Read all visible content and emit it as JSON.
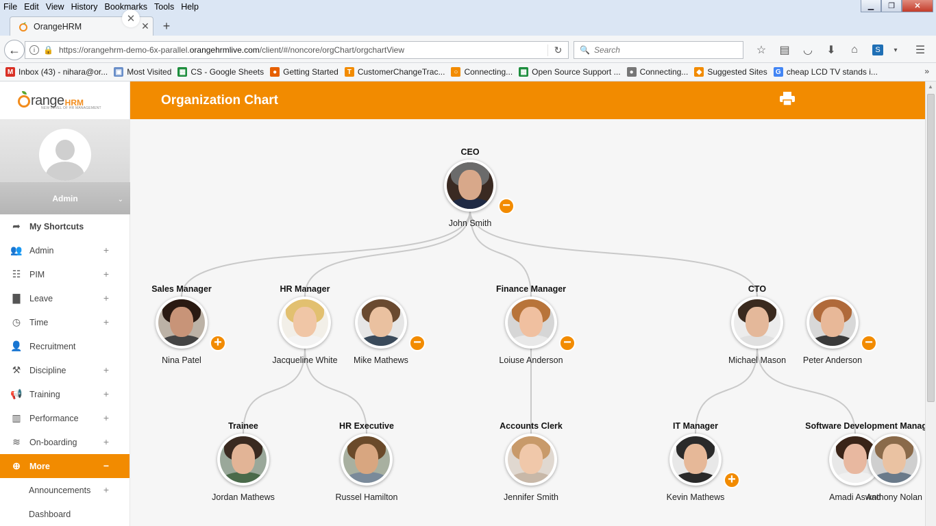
{
  "browser": {
    "menu": [
      "File",
      "Edit",
      "View",
      "History",
      "Bookmarks",
      "Tools",
      "Help"
    ],
    "tab_title": "OrangeHRM",
    "url_prefix": "https://orangehrm-demo-6x-parallel.",
    "url_domain": "orangehrmlive.com",
    "url_suffix": "/client/#/noncore/orgChart/orgchartView",
    "search_placeholder": "Search",
    "bookmarks": [
      {
        "label": "Inbox (43) - nihara@or...",
        "icon": "gmail-icon",
        "color": "#d93025",
        "glyph": "M"
      },
      {
        "label": "Most Visited",
        "icon": "folder-icon",
        "color": "#6a8fc9",
        "glyph": "▣"
      },
      {
        "label": "CS - Google Sheets",
        "icon": "sheets-icon",
        "color": "#1e8e3e",
        "glyph": "▦"
      },
      {
        "label": "Getting Started",
        "icon": "firefox-icon",
        "color": "#e66000",
        "glyph": "●"
      },
      {
        "label": "CustomerChangeTrac...",
        "icon": "tracker-icon",
        "color": "#f28b00",
        "glyph": "T"
      },
      {
        "label": "Connecting...",
        "icon": "orangehrm-icon",
        "color": "#f28b00",
        "glyph": "○"
      },
      {
        "label": "Open Source Support ...",
        "icon": "sheets-icon",
        "color": "#1e8e3e",
        "glyph": "▦"
      },
      {
        "label": "Connecting...",
        "icon": "globe-icon",
        "color": "#777777",
        "glyph": "●"
      },
      {
        "label": "Suggested Sites",
        "icon": "suggested-icon",
        "color": "#f28b00",
        "glyph": "◆"
      },
      {
        "label": "cheap LCD TV stands i...",
        "icon": "google-icon",
        "color": "#4285f4",
        "glyph": "G"
      }
    ]
  },
  "sidebar": {
    "logo_text": "range",
    "logo_hrm": "HRM",
    "logo_tagline": "NEW LEVEL OF HR MANAGEMENT",
    "user": "Admin",
    "items": [
      {
        "label": "My Shortcuts",
        "icon": "share-arrow-icon",
        "glyph": "➦",
        "plus": false,
        "style": "bold"
      },
      {
        "label": "Admin",
        "icon": "admin-users-icon",
        "glyph": "👥",
        "plus": true,
        "style": ""
      },
      {
        "label": "PIM",
        "icon": "pim-icon",
        "glyph": "☷",
        "plus": true,
        "style": ""
      },
      {
        "label": "Leave",
        "icon": "briefcase-icon",
        "glyph": "▇",
        "plus": true,
        "style": ""
      },
      {
        "label": "Time",
        "icon": "clock-icon",
        "glyph": "◷",
        "plus": true,
        "style": ""
      },
      {
        "label": "Recruitment",
        "icon": "recruitment-icon",
        "glyph": "👤",
        "plus": false,
        "style": ""
      },
      {
        "label": "Discipline",
        "icon": "gavel-icon",
        "glyph": "⚒",
        "plus": true,
        "style": ""
      },
      {
        "label": "Training",
        "icon": "megaphone-icon",
        "glyph": "📢",
        "plus": true,
        "style": ""
      },
      {
        "label": "Performance",
        "icon": "bar-chart-icon",
        "glyph": "▥",
        "plus": true,
        "style": ""
      },
      {
        "label": "On-boarding",
        "icon": "stack-icon",
        "glyph": "≋",
        "plus": true,
        "style": ""
      },
      {
        "label": "More",
        "icon": "plus-circle-icon",
        "glyph": "⊕",
        "plus": true,
        "minus": true,
        "style": "active"
      }
    ],
    "subitems": [
      {
        "label": "Announcements",
        "plus": true
      },
      {
        "label": "Dashboard",
        "plus": false
      }
    ]
  },
  "main": {
    "title": "Organization Chart"
  },
  "org": {
    "nodes": [
      {
        "id": "ceo",
        "title": "CEO",
        "name": "John Smith",
        "toggle": "minus",
        "hair": "#6b6b6b",
        "skin": "#d8a88a",
        "shirt": "#1f2a44",
        "bg": "#3a2a22"
      },
      {
        "id": "sales",
        "title": "Sales Manager",
        "name": "Nina Patel",
        "toggle": "plus",
        "hair": "#2a1a12",
        "skin": "#c89478",
        "shirt": "#444444",
        "bg": "#bcb2a6"
      },
      {
        "id": "hr",
        "title": "HR Manager",
        "name": "Jacqueline White",
        "toggle": "",
        "hair": "#e2c070",
        "skin": "#f0c6a6",
        "shirt": "#f3f3f3",
        "bg": "#f2efe8"
      },
      {
        "id": "mike",
        "title": "",
        "name": "Mike Mathews",
        "toggle": "minus",
        "hair": "#6a4a30",
        "skin": "#eac1a0",
        "shirt": "#3a4a5a",
        "bg": "#e6e6e6"
      },
      {
        "id": "fin",
        "title": "Finance Manager",
        "name": "Loiuse Anderson",
        "toggle": "minus",
        "hair": "#b8743a",
        "skin": "#f0c0a0",
        "shirt": "#e8e8e8",
        "bg": "#d6d6d6"
      },
      {
        "id": "cto",
        "title": "CTO",
        "name": "Michael Mason",
        "toggle": "",
        "hair": "#3a2a1e",
        "skin": "#e4b89a",
        "shirt": "#e0e0e0",
        "bg": "#ececec"
      },
      {
        "id": "peter",
        "title": "",
        "name": "Peter Anderson",
        "toggle": "minus",
        "hair": "#b06a3a",
        "skin": "#e8b898",
        "shirt": "#3a3a3a",
        "bg": "#d8d8d8"
      },
      {
        "id": "trainee",
        "title": "Trainee",
        "name": "Jordan Mathews",
        "toggle": "",
        "hair": "#3a2a20",
        "skin": "#e2b496",
        "shirt": "#4a6a4a",
        "bg": "#9aa89a"
      },
      {
        "id": "hrexec",
        "title": "HR Executive",
        "name": "Russel Hamilton",
        "toggle": "",
        "hair": "#6a4a2a",
        "skin": "#d8a680",
        "shirt": "#7a8a9a",
        "bg": "#a8b0a0"
      },
      {
        "id": "clerk",
        "title": "Accounts Clerk",
        "name": "Jennifer Smith",
        "toggle": "",
        "hair": "#c89a6a",
        "skin": "#f0c8aa",
        "shirt": "#c8b8a8",
        "bg": "#e0d8d0"
      },
      {
        "id": "it",
        "title": "IT Manager",
        "name": "Kevin Mathews",
        "toggle": "plus",
        "hair": "#2a2a2a",
        "skin": "#e6b898",
        "shirt": "#2a2a2a",
        "bg": "#e8e8e8"
      },
      {
        "id": "sdm",
        "title": "Software Development Manager",
        "name": "Amadi Aswad",
        "toggle": "",
        "hair": "#3a2418",
        "skin": "#e8b8a0",
        "shirt": "#f0f0f0",
        "bg": "#e8e8e8"
      },
      {
        "id": "anthony",
        "title": "",
        "name": "Anthony Nolan",
        "toggle": "",
        "hair": "#8a6a4a",
        "skin": "#eac2a2",
        "shirt": "#6a7a8a",
        "bg": "#cfcfcf"
      }
    ]
  }
}
